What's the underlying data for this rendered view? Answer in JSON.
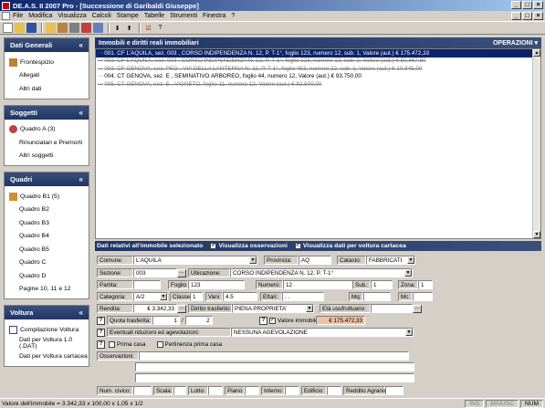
{
  "window": {
    "title": "DE.A.S. II 2007 Pro - [Successione di Garibaldi Giuseppe]"
  },
  "menu": [
    "File",
    "Modifica",
    "Visualizza",
    "Calcoli",
    "Stampe",
    "Tabelle",
    "Strumenti",
    "Finestra",
    "?"
  ],
  "sidebar": {
    "sections": [
      {
        "title": "Dati Generali",
        "items": [
          "Frontespizio",
          "Allegati",
          "Altri dati"
        ]
      },
      {
        "title": "Soggetti",
        "items": [
          "Quadro A (3)",
          "Rinunciatari e Premorti",
          "Altri soggetti"
        ]
      },
      {
        "title": "Quadri",
        "items": [
          "Quadro B1 (5)",
          "Quadro B2",
          "Quadro B3",
          "Quadro B4",
          "Quadro B5",
          "Quadro C",
          "Quadro D",
          "Pagine 10, 11 e 12"
        ]
      },
      {
        "title": "Voltura",
        "items": [
          "Compilazione Voltura",
          "Dati per Voltura 1.0 (.DAT)",
          "Dati per Voltura cartacea"
        ]
      }
    ]
  },
  "main": {
    "header": "Immobili e diritti reali immobiliari",
    "operations": "OPERAZIONI",
    "rows": [
      "001. CF L'AQUILA, sez. 003 , CORSO INDIPENDENZA N. 12, P. T-1°, foglio 123, numero 12, sub. 1, Valore (aut.) € 175.472,33",
      "002. CF L'AQUILA, sez. 003 , CORSO INDIPENDENZA N. 12, P. T-1°, foglio 123, numero 12, sub. 2, Valore (aut.) € 50.867,50",
      "003. CF GENOVA, sez. PEG , VIA DELLA LANTERNA N. 11, P. T-1°, foglio 453, numero 22, sub. 1, Valore (aut.) € 10.845,00",
      "004. CT GENOVA, sez. E , SEMINATIVO ARBOREO, foglio 44, numero 12, Valore (aut.) € 93.750,00",
      "005. CT GENOVA, sez. E , VIGNETO, foglio 11, numero 12, Valore (aut.) € 82.500,00"
    ]
  },
  "detail": {
    "header": "Dati relativi all'immobile selezionato",
    "chk_oss": "Visualizza osservazioni",
    "chk_cart": "Visualizza dati per voltura cartacea",
    "comune_l": "Comune:",
    "comune": "L'AQUILA",
    "prov_l": "Provincia:",
    "prov": "AQ",
    "catasto_l": "Catasto:",
    "catasto": "FABBRICATI",
    "sezione_l": "Sezione:",
    "sezione": "003",
    "ubic_l": "Ubicazione:",
    "ubic": "CORSO INDIPENDENZA N. 12, P. T-1°",
    "partita_l": "Partita:",
    "foglio_l": "Foglio:",
    "foglio": "123",
    "numero_l": "Numero:",
    "numero": "12",
    "sub_l": "Sub.:",
    "sub": "1",
    "zona_l": "Zona:",
    "zona": "1",
    "cat_l": "Categoria:",
    "cat": "A/2",
    "classe_l": "Classe:",
    "classe": "1",
    "vani_l": "Vani:",
    "vani": "4.5",
    "ettari_l": "Ettari:",
    "ettari": ". .",
    "mq_l": "Mq:",
    "mc_l": "Mc:",
    "rendita_l": "Rendita:",
    "rendita": "€ 3.342,33",
    "diritto_l": "Diritto trasferito:",
    "diritto": "PIENA PROPRIETA'",
    "eta_l": "Età usufruttuario:",
    "quota_l": "Quota trasferita:",
    "quota_num": "1",
    "quota_sep": "/",
    "quota_den": "2",
    "valore_l": "Valore immobile:",
    "valore": "€ 175.472,33",
    "rid_l": "Eventuali riduzioni ed agevolazioni:",
    "rid": "NESSUNA AGEVOLAZIONE",
    "prima_l": "Prima casa",
    "pert_l": "Pertinenza prima casa",
    "oss_l": "Osservazioni:",
    "civico_l": "Num. civico:",
    "scala_l": "Scala:",
    "lotto_l": "Lotto:",
    "piano_l": "Piano:",
    "interno_l": "Interno:",
    "edificio_l": "Edificio:",
    "redd_l": "Reddito Agrario:"
  },
  "status": {
    "text": "Valore dell'immobile = 3.342,33 x 100,00 x 1,05 x 1/2",
    "ins": "INS",
    "caps": "MAIUSC",
    "num": "NUM"
  }
}
